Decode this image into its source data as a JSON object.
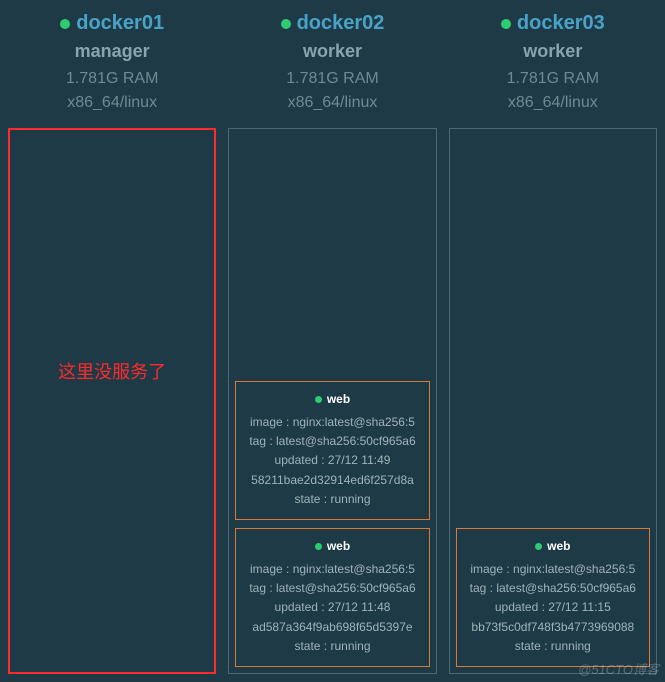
{
  "watermark": "@51CTO博客",
  "nodes": [
    {
      "name": "docker01",
      "role": "manager",
      "ram": "1.781G RAM",
      "arch": "x86_64/linux",
      "highlight": true,
      "empty_text": "这里没服务了",
      "tasks": []
    },
    {
      "name": "docker02",
      "role": "worker",
      "ram": "1.781G RAM",
      "arch": "x86_64/linux",
      "highlight": false,
      "tasks": [
        {
          "service": "web",
          "image": "image : nginx:latest@sha256:5",
          "tag": "tag : latest@sha256:50cf965a6",
          "updated": "updated : 27/12 11:49",
          "id": "58211bae2d32914ed6f257d8a",
          "state": "state : running"
        },
        {
          "service": "web",
          "image": "image : nginx:latest@sha256:5",
          "tag": "tag : latest@sha256:50cf965a6",
          "updated": "updated : 27/12 11:48",
          "id": "ad587a364f9ab698f65d5397e",
          "state": "state : running"
        }
      ]
    },
    {
      "name": "docker03",
      "role": "worker",
      "ram": "1.781G RAM",
      "arch": "x86_64/linux",
      "highlight": false,
      "tasks": [
        {
          "service": "web",
          "image": "image : nginx:latest@sha256:5",
          "tag": "tag : latest@sha256:50cf965a6",
          "updated": "updated : 27/12 11:15",
          "id": "bb73f5c0df748f3b4773969088",
          "state": "state : running"
        }
      ]
    }
  ]
}
